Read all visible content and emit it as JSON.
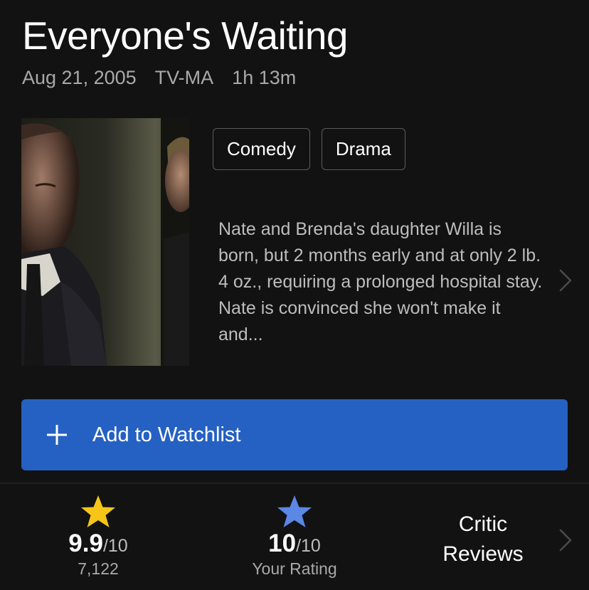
{
  "title": "Everyone's Waiting",
  "meta": {
    "date": "Aug 21, 2005",
    "rating": "TV-MA",
    "runtime": "1h 13m"
  },
  "genres": [
    "Comedy",
    "Drama"
  ],
  "plot": "Nate and Brenda's daughter Willa is born, but 2 months early and at only 2 lb. 4 oz., requiring a prolonged hospital stay. Nate is convinced she won't make it and...",
  "watchlist": {
    "label": "Add to Watchlist"
  },
  "ratings": {
    "imdb": {
      "value": "9.9",
      "out_of": "/10",
      "count": "7,122",
      "star_color": "#f5c518"
    },
    "user": {
      "value": "10",
      "out_of": "/10",
      "label": "Your Rating",
      "star_color": "#5b87e5"
    },
    "critic": {
      "line1": "Critic",
      "line2": "Reviews"
    }
  },
  "colors": {
    "background": "#121212",
    "accent": "#2561c2"
  },
  "icons": {
    "plus": "plus-icon",
    "chevron": "chevron-right-icon",
    "star": "star-icon"
  }
}
